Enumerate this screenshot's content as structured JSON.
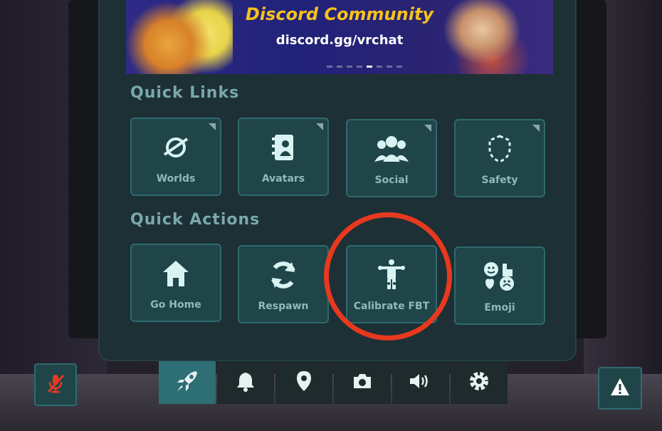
{
  "banner": {
    "title": "Discord Community",
    "link": "discord.gg/vrchat"
  },
  "quick_links": {
    "title": "Quick Links",
    "items": [
      {
        "label": "Worlds",
        "icon": "planet-icon"
      },
      {
        "label": "Avatars",
        "icon": "avatar-book-icon"
      },
      {
        "label": "Social",
        "icon": "people-icon"
      },
      {
        "label": "Safety",
        "icon": "shield-icon"
      }
    ]
  },
  "quick_actions": {
    "title": "Quick Actions",
    "items": [
      {
        "label": "Go Home",
        "icon": "home-icon"
      },
      {
        "label": "Respawn",
        "icon": "respawn-icon"
      },
      {
        "label": "Calibrate FBT",
        "icon": "calibrate-body-icon"
      },
      {
        "label": "Emoji",
        "icon": "emoji-icon"
      }
    ]
  },
  "bottom_tabs": [
    {
      "icon": "rocket-icon",
      "active": true
    },
    {
      "icon": "bell-icon"
    },
    {
      "icon": "location-pin-icon"
    },
    {
      "icon": "camera-icon"
    },
    {
      "icon": "speaker-icon"
    },
    {
      "icon": "gear-icon"
    }
  ],
  "side_buttons": {
    "mic": "muted-mic-icon",
    "warning": "warning-icon"
  },
  "colors": {
    "accent": "#2d6f74",
    "highlight_circle": "#e8391f",
    "banner_title": "#f6c21a"
  }
}
